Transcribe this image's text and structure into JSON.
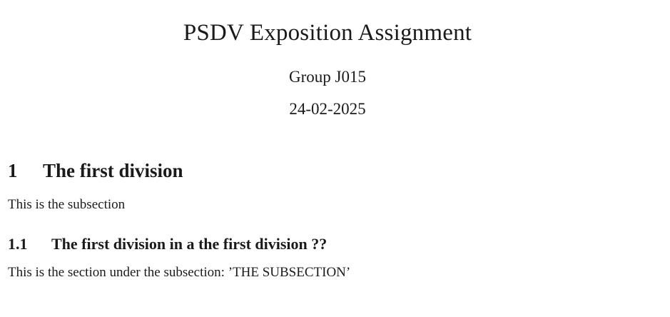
{
  "document": {
    "title": "PSDV Exposition Assignment",
    "author": "Group J015",
    "date": "24-02-2025"
  },
  "sections": [
    {
      "number": "1",
      "heading": "The first division",
      "text": "This is the subsection",
      "subsections": [
        {
          "number": "1.1",
          "heading": "The first division in a the first division ??",
          "text": "This is the section under the subsection: ’THE SUBSECTION’"
        }
      ]
    }
  ]
}
